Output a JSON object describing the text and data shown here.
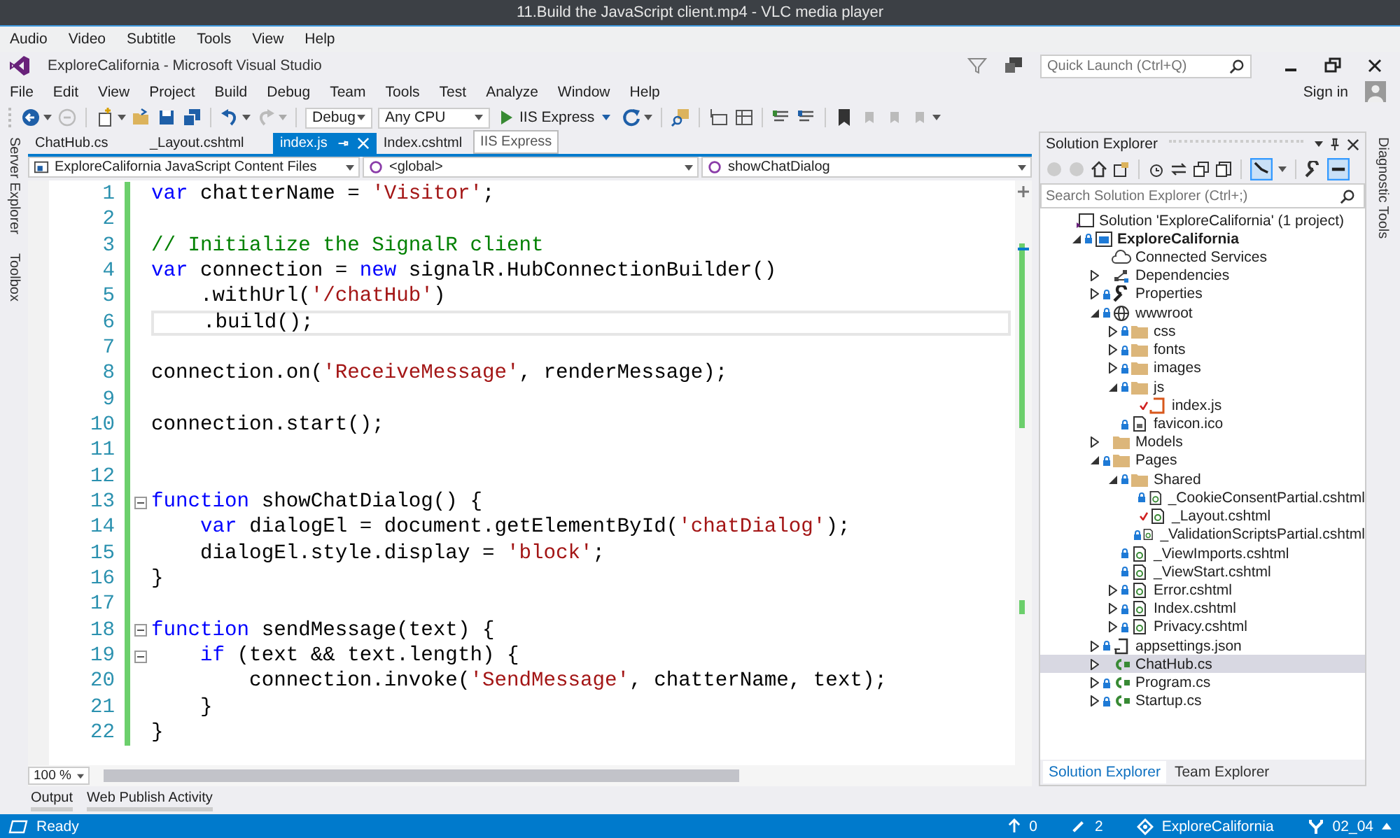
{
  "player": {
    "title": "11.Build the JavaScript client.mp4 - VLC media player",
    "menu": [
      "Audio",
      "Video",
      "Subtitle",
      "Tools",
      "View",
      "Help"
    ]
  },
  "vs": {
    "title": "ExploreCalifornia - Microsoft Visual Studio",
    "menu": [
      "File",
      "Edit",
      "View",
      "Project",
      "Build",
      "Debug",
      "Team",
      "Tools",
      "Test",
      "Analyze",
      "Window",
      "Help"
    ],
    "quick_launch": {
      "placeholder": "Quick Launch (Ctrl+Q)"
    },
    "sign_in": "Sign in"
  },
  "toolbar": {
    "configuration": "Debug",
    "platform": "Any CPU",
    "run": "IIS Express"
  },
  "side_tabs": [
    "Server Explorer",
    "Toolbox"
  ],
  "editor": {
    "tabs": [
      {
        "label": "ChatHub.cs",
        "selected": false
      },
      {
        "label": "_Layout.cshtml",
        "selected": false
      },
      {
        "label": "index.js",
        "selected": true
      },
      {
        "label": "Index.cshtml",
        "selected": false
      }
    ],
    "tooltip": "IIS Express",
    "nav": [
      "ExploreCalifornia JavaScript Content Files",
      "<global>",
      "showChatDialog"
    ],
    "lines": [
      {
        "n": "1",
        "fold": false,
        "current": false,
        "tokens": [
          {
            "kind": "keyword",
            "text": "var"
          },
          {
            "kind": "plain",
            "text": " chatterName = "
          },
          {
            "kind": "string",
            "text": "'Visitor'"
          },
          {
            "kind": "plain",
            "text": ";"
          }
        ]
      },
      {
        "n": "2",
        "fold": false,
        "current": false
      },
      {
        "n": "3",
        "fold": false,
        "current": false,
        "tokens": [
          {
            "kind": "comment",
            "text": "// Initialize the SignalR client"
          }
        ]
      },
      {
        "n": "4",
        "fold": false,
        "current": false,
        "tokens": [
          {
            "kind": "keyword",
            "text": "var"
          },
          {
            "kind": "plain",
            "text": " connection = "
          },
          {
            "kind": "keyword",
            "text": "new"
          },
          {
            "kind": "plain",
            "text": " signalR.HubConnectionBuilder()"
          }
        ]
      },
      {
        "n": "5",
        "fold": false,
        "current": false,
        "tokens": [
          {
            "kind": "plain",
            "text": "    .withUrl("
          },
          {
            "kind": "string",
            "text": "'/chatHub'"
          },
          {
            "kind": "plain",
            "text": ")"
          }
        ]
      },
      {
        "n": "6",
        "fold": false,
        "current": true,
        "tokens": [
          {
            "kind": "plain",
            "text": "    .build();"
          }
        ]
      },
      {
        "n": "7",
        "fold": false,
        "current": false
      },
      {
        "n": "8",
        "fold": false,
        "current": false,
        "tokens": [
          {
            "kind": "plain",
            "text": "connection.on("
          },
          {
            "kind": "string",
            "text": "'ReceiveMessage'"
          },
          {
            "kind": "plain",
            "text": ", renderMessage);"
          }
        ]
      },
      {
        "n": "9",
        "fold": false,
        "current": false
      },
      {
        "n": "10",
        "fold": false,
        "current": false,
        "tokens": [
          {
            "kind": "plain",
            "text": "connection.start();"
          }
        ]
      },
      {
        "n": "11",
        "fold": false,
        "current": false
      },
      {
        "n": "12",
        "fold": false,
        "current": false
      },
      {
        "n": "13",
        "fold": true,
        "current": false,
        "tokens": [
          {
            "kind": "keyword",
            "text": "function"
          },
          {
            "kind": "plain",
            "text": " showChatDialog() {"
          }
        ]
      },
      {
        "n": "14",
        "fold": false,
        "current": false,
        "tokens": [
          {
            "kind": "keyword",
            "text": "    var"
          },
          {
            "kind": "plain",
            "text": " dialogEl = document.getElementById("
          },
          {
            "kind": "string",
            "text": "'chatDialog'"
          },
          {
            "kind": "plain",
            "text": ");"
          }
        ]
      },
      {
        "n": "15",
        "fold": false,
        "current": false,
        "tokens": [
          {
            "kind": "plain",
            "text": "    dialogEl.style.display = "
          },
          {
            "kind": "string",
            "text": "'block'"
          },
          {
            "kind": "plain",
            "text": ";"
          }
        ]
      },
      {
        "n": "16",
        "fold": false,
        "current": false,
        "tokens": [
          {
            "kind": "plain",
            "text": "}"
          }
        ]
      },
      {
        "n": "17",
        "fold": false,
        "current": false
      },
      {
        "n": "18",
        "fold": true,
        "current": false,
        "tokens": [
          {
            "kind": "keyword",
            "text": "function"
          },
          {
            "kind": "plain",
            "text": " sendMessage(text) {"
          }
        ]
      },
      {
        "n": "19",
        "fold": true,
        "current": false,
        "tokens": [
          {
            "kind": "keyword",
            "text": "    if"
          },
          {
            "kind": "plain",
            "text": " (text && text.length) {"
          }
        ]
      },
      {
        "n": "20",
        "fold": false,
        "current": false,
        "tokens": [
          {
            "kind": "plain",
            "text": "        connection.invoke("
          },
          {
            "kind": "string",
            "text": "'SendMessage'"
          },
          {
            "kind": "plain",
            "text": ", chatterName, text);"
          }
        ]
      },
      {
        "n": "21",
        "fold": false,
        "current": false,
        "tokens": [
          {
            "kind": "plain",
            "text": "    }"
          }
        ]
      },
      {
        "n": "22",
        "fold": false,
        "current": false,
        "tokens": [
          {
            "kind": "plain",
            "text": "}"
          }
        ]
      }
    ],
    "zoom": "100 %"
  },
  "solution_explorer": {
    "title": "Solution Explorer",
    "search": {
      "placeholder": "Search Solution Explorer (Ctrl+;)"
    },
    "tree": [
      {
        "label": "Solution 'ExploreCalifornia' (1 project)",
        "kind": "solution",
        "locked": false,
        "modified": false,
        "selected": false,
        "children": [
          {
            "label": "ExploreCalifornia",
            "kind": "project",
            "expanded": true,
            "locked": true,
            "modified": false,
            "selected": false,
            "children": [
              {
                "label": "Connected Services",
                "kind": "cloud",
                "locked": false,
                "modified": false,
                "selected": false
              },
              {
                "label": "Dependencies",
                "kind": "dependencies",
                "expanded": false,
                "locked": false,
                "modified": false,
                "selected": false
              },
              {
                "label": "Properties",
                "kind": "wrench",
                "expanded": false,
                "locked": true,
                "modified": false,
                "selected": false
              },
              {
                "label": "wwwroot",
                "kind": "globe",
                "expanded": true,
                "locked": true,
                "modified": false,
                "selected": false,
                "children": [
                  {
                    "label": "css",
                    "kind": "folder",
                    "expanded": false,
                    "locked": true,
                    "modified": false,
                    "selected": false
                  },
                  {
                    "label": "fonts",
                    "kind": "folder",
                    "expanded": false,
                    "locked": true,
                    "modified": false,
                    "selected": false
                  },
                  {
                    "label": "images",
                    "kind": "folder",
                    "expanded": false,
                    "locked": true,
                    "modified": false,
                    "selected": false
                  },
                  {
                    "label": "js",
                    "kind": "folder",
                    "expanded": true,
                    "locked": true,
                    "modified": false,
                    "selected": false,
                    "children": [
                      {
                        "label": "index.js",
                        "kind": "script",
                        "locked": false,
                        "modified": true,
                        "selected": false
                      }
                    ]
                  },
                  {
                    "label": "favicon.ico",
                    "kind": "file",
                    "locked": true,
                    "modified": false,
                    "selected": false
                  }
                ]
              },
              {
                "label": "Models",
                "kind": "folder",
                "expanded": false,
                "locked": false,
                "modified": false,
                "selected": false
              },
              {
                "label": "Pages",
                "kind": "folder",
                "expanded": true,
                "locked": true,
                "modified": false,
                "selected": false,
                "children": [
                  {
                    "label": "Shared",
                    "kind": "folder",
                    "expanded": true,
                    "locked": true,
                    "modified": false,
                    "selected": false,
                    "children": [
                      {
                        "label": "_CookieConsentPartial.cshtml",
                        "kind": "page",
                        "locked": true,
                        "modified": false,
                        "selected": false
                      },
                      {
                        "label": "_Layout.cshtml",
                        "kind": "page",
                        "locked": false,
                        "modified": true,
                        "selected": false
                      },
                      {
                        "label": "_ValidationScriptsPartial.cshtml",
                        "kind": "page",
                        "locked": true,
                        "modified": false,
                        "selected": false
                      }
                    ]
                  },
                  {
                    "label": "_ViewImports.cshtml",
                    "kind": "page",
                    "locked": true,
                    "modified": false,
                    "selected": false
                  },
                  {
                    "label": "_ViewStart.cshtml",
                    "kind": "page",
                    "locked": true,
                    "modified": false,
                    "selected": false
                  },
                  {
                    "label": "Error.cshtml",
                    "kind": "page",
                    "expanded": false,
                    "locked": true,
                    "modified": false,
                    "selected": false
                  },
                  {
                    "label": "Index.cshtml",
                    "kind": "page",
                    "expanded": false,
                    "locked": true,
                    "modified": false,
                    "selected": false
                  },
                  {
                    "label": "Privacy.cshtml",
                    "kind": "page",
                    "expanded": false,
                    "locked": true,
                    "modified": false,
                    "selected": false
                  }
                ]
              },
              {
                "label": "appsettings.json",
                "kind": "json",
                "expanded": false,
                "locked": true,
                "modified": false,
                "selected": false
              },
              {
                "label": "ChatHub.cs",
                "kind": "csharp",
                "expanded": false,
                "locked": false,
                "modified": false,
                "selected": true
              },
              {
                "label": "Program.cs",
                "kind": "csharp",
                "expanded": false,
                "locked": true,
                "modified": false,
                "selected": false
              },
              {
                "label": "Startup.cs",
                "kind": "csharp",
                "expanded": false,
                "locked": true,
                "modified": false,
                "selected": false
              }
            ]
          }
        ]
      }
    ],
    "tabs": [
      {
        "label": "Solution Explorer",
        "selected": true
      },
      {
        "label": "Team Explorer",
        "selected": false
      }
    ]
  },
  "right_tabs": [
    "Diagnostic Tools"
  ],
  "bottom_tabs": [
    "Output",
    "Web Publish Activity"
  ],
  "status_bar": {
    "message": "Ready",
    "push": "0",
    "changes": "2",
    "repo": "ExploreCalifornia",
    "branch": "02_04"
  }
}
